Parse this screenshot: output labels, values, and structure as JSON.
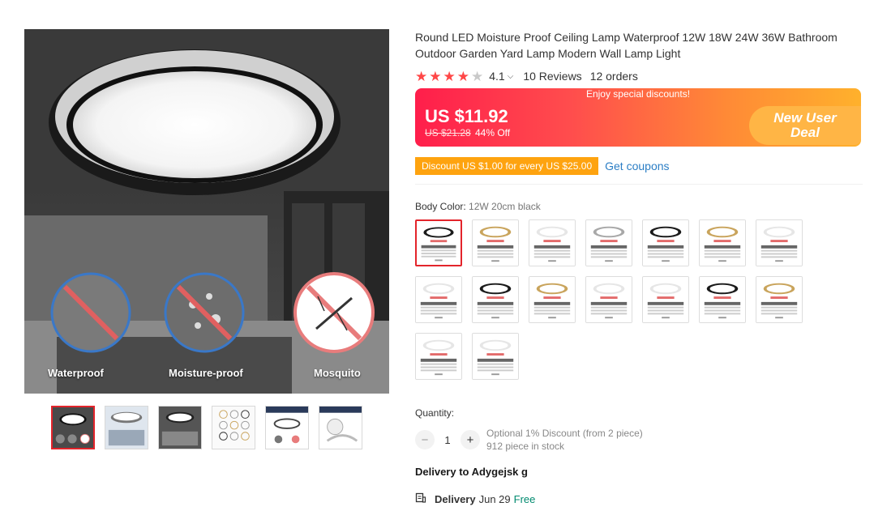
{
  "gallery": {
    "features": [
      {
        "label": "Waterproof"
      },
      {
        "label": "Moisture-proof"
      },
      {
        "label": "Mosquito"
      }
    ],
    "thumbnail_count": 6,
    "active_thumbnail": 0
  },
  "product": {
    "title": "Round LED Moisture Proof Ceiling Lamp Waterproof 12W 18W 24W 36W Bathroom Outdoor Garden Yard Lamp Modern Wall Lamp Light",
    "rating": "4.1",
    "stars_filled": 4,
    "stars_total": 5,
    "reviews": "10 Reviews",
    "orders": "12 orders"
  },
  "price": {
    "banner_text": "Enjoy special discounts!",
    "current": "US $11.92",
    "original": "US $21.28",
    "discount": "44% Off",
    "deal_line1": "New User",
    "deal_line2": "Deal",
    "colors": {
      "start": "#ff1e4b",
      "end": "#ffb12c"
    }
  },
  "coupon": {
    "tag": "Discount US $1.00 for every US $25.00",
    "link": "Get coupons"
  },
  "variant": {
    "label": "Body Color:",
    "selected": "12W 20cm black",
    "swatches": [
      {
        "frame": "black"
      },
      {
        "frame": "gold"
      },
      {
        "frame": "white"
      },
      {
        "frame": "silver"
      },
      {
        "frame": "black"
      },
      {
        "frame": "gold"
      },
      {
        "frame": "white"
      },
      {
        "frame": "white"
      },
      {
        "frame": "black"
      },
      {
        "frame": "gold"
      },
      {
        "frame": "white"
      },
      {
        "frame": "white"
      },
      {
        "frame": "black"
      },
      {
        "frame": "gold"
      },
      {
        "frame": "white"
      },
      {
        "frame": "white"
      }
    ],
    "selected_index": 0
  },
  "quantity": {
    "label": "Quantity:",
    "value": "1",
    "minus": "−",
    "plus": "+",
    "discount_note": "Optional 1% Discount (from 2 piece)",
    "stock": "912 piece in stock"
  },
  "shipping": {
    "deliver_to": "Delivery to Adygejsk g",
    "title": "Delivery",
    "date": "Jun 29",
    "cost": "Free"
  }
}
